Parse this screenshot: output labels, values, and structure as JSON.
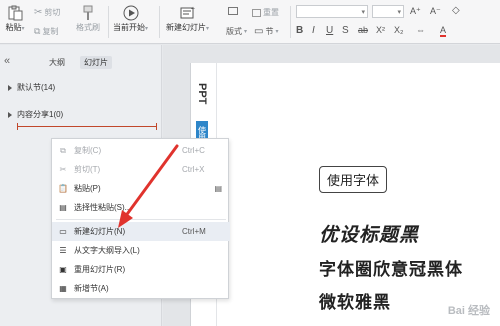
{
  "ribbon": {
    "paste": "粘贴",
    "cut": "剪切",
    "copy": "复制",
    "format_painter": "格式刷",
    "start_from_current": "当前开始",
    "new_slide": "新建幻灯片",
    "layout": "版式",
    "reset": "重置",
    "section": "节",
    "icons": {
      "paste": "paste-icon",
      "cut": "scissors-icon",
      "copy": "copy-icon",
      "format_painter": "brush-icon",
      "play": "play-icon",
      "new_slide": "new-slide-icon",
      "layout": "layout-icon",
      "reset": "reset-icon",
      "section": "section-icon"
    }
  },
  "left_panel": {
    "collapse_symbol": "«",
    "tab_outline": "大纲",
    "tab_slides": "幻灯片",
    "sections": [
      {
        "label": "默认节(14)"
      },
      {
        "label": "内容分享1(0)"
      }
    ]
  },
  "context_menu": {
    "items": [
      {
        "label": "复制(C)",
        "shortcut": "Ctrl+C",
        "icon": "copy-icon",
        "disabled": true
      },
      {
        "label": "剪切(T)",
        "shortcut": "Ctrl+X",
        "icon": "scissors-icon",
        "disabled": true
      },
      {
        "label": "粘贴(P)",
        "shortcut": "",
        "icon": "paste-icon",
        "disabled": false
      },
      {
        "label": "选择性粘贴(S)...",
        "shortcut": "",
        "icon": "paste-special-icon",
        "disabled": false
      },
      {
        "label": "新建幻灯片(N)",
        "shortcut": "Ctrl+M",
        "icon": "new-slide-icon",
        "disabled": false,
        "highlighted": true
      },
      {
        "label": "从文字大纲导入(L)",
        "shortcut": "",
        "icon": "import-outline-icon",
        "disabled": false
      },
      {
        "label": "重用幻灯片(R)",
        "shortcut": "",
        "icon": "reuse-slide-icon",
        "disabled": false
      },
      {
        "label": "新增节(A)",
        "shortcut": "",
        "icon": "new-section-icon",
        "disabled": false
      }
    ]
  },
  "slide_preview": {
    "edge_title": "PPT",
    "edge_tag": "使用",
    "boxed_text": "使用字体",
    "lines": [
      "优设标题黑",
      "字体圈欣意冠黑体",
      "微软雅黑"
    ]
  },
  "watermark": "Bai 经验",
  "colors": {
    "accent_blue": "#2e86c9",
    "section_divider_red": "#c1472b",
    "arrow_red": "#e0332d"
  }
}
